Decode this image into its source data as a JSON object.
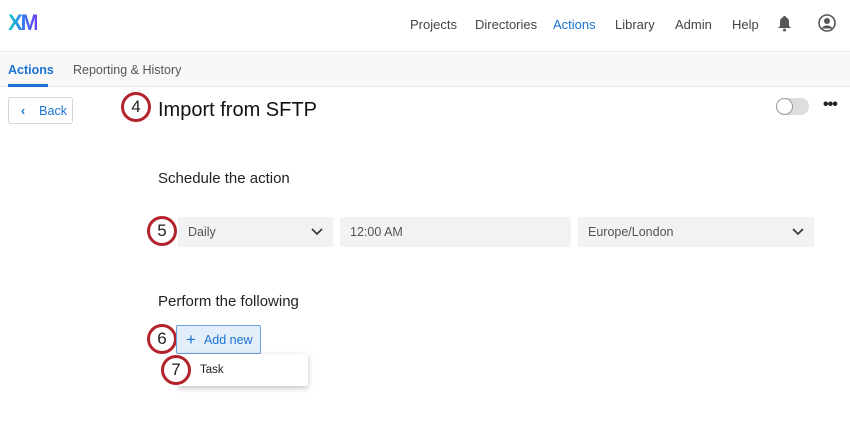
{
  "header": {
    "logo": "XM",
    "nav": [
      "Projects",
      "Directories",
      "Actions",
      "Library",
      "Admin",
      "Help"
    ],
    "active": "Actions"
  },
  "tabs": [
    "Actions",
    "Reporting & History"
  ],
  "back_label": "Back",
  "badges": [
    "4",
    "5",
    "6",
    "7"
  ],
  "title": "Import from SFTP",
  "schedule": {
    "label": "Schedule the action",
    "frequency": "Daily",
    "time": "12:00 AM",
    "timezone": "Europe/London"
  },
  "perform": {
    "label": "Perform the following",
    "add_new": "Add new",
    "menu_items": [
      "Task"
    ]
  },
  "colors": {
    "accent": "#1a73d1",
    "badge": "#b3232c"
  }
}
